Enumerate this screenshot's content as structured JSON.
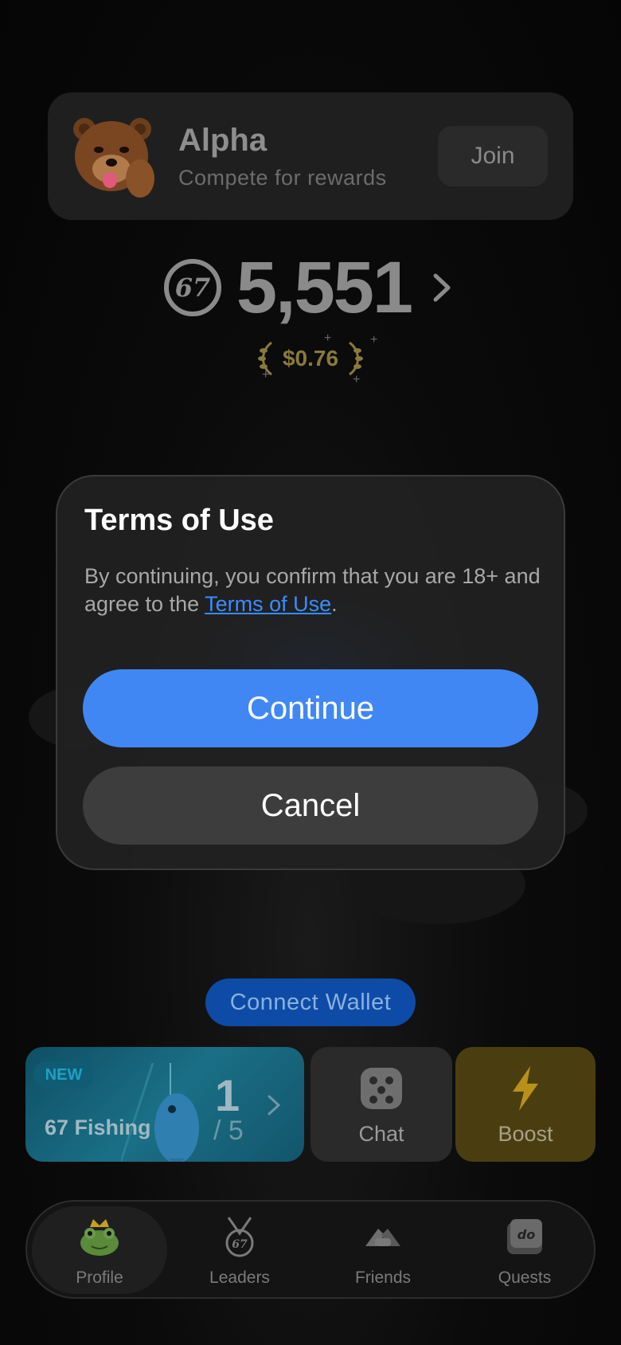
{
  "alpha_card": {
    "title": "Alpha",
    "subtitle": "Compete for rewards",
    "join_label": "Join"
  },
  "balance": {
    "amount": "5,551",
    "usd_value": "$0.76",
    "coin_icon": "67-coin-icon"
  },
  "modal": {
    "title": "Terms of Use",
    "text_before": "By continuing, you confirm that you are 18+ and agree to the ",
    "link_text": "Terms of Use",
    "text_after": ".",
    "continue_label": "Continue",
    "cancel_label": "Cancel"
  },
  "connect_wallet_label": "Connect Wallet",
  "tiles": {
    "fishing": {
      "badge": "NEW",
      "title": "67 Fishing",
      "count": "1",
      "total": "/ 5"
    },
    "chat": {
      "label": "Chat",
      "icon": "dice-icon"
    },
    "boost": {
      "label": "Boost",
      "icon": "lightning-icon"
    }
  },
  "nav": {
    "items": [
      {
        "label": "Profile",
        "icon": "frog-crown-icon",
        "active": true
      },
      {
        "label": "Leaders",
        "icon": "medal-icon"
      },
      {
        "label": "Friends",
        "icon": "handshake-icon"
      },
      {
        "label": "Quests",
        "icon": "do-key-icon"
      }
    ]
  },
  "colors": {
    "accent": "#4087f4",
    "link": "#3b8cff",
    "cancel": "#3d3d3d",
    "modal_bg": "#222222"
  }
}
